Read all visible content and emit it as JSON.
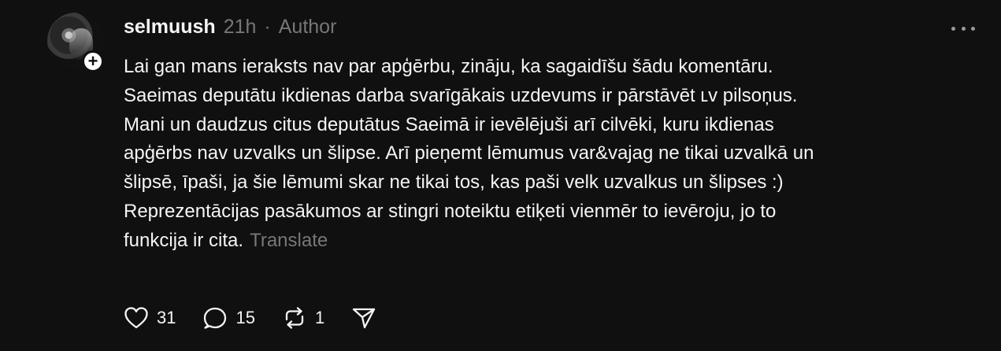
{
  "post": {
    "username": "selmuush",
    "time": "21h",
    "separator": "·",
    "author_badge": "Author",
    "follow_symbol": "+",
    "body_lines": [
      "Lai gan mans ieraksts nav par apģērbu, zināju, ka sagaidīšu šādu komentāru.",
      "Saeimas deputātu ikdienas darba svarīgākais uzdevums ir pārstāvēt ʟv pilsoņus.",
      "Mani un daudzus citus deputātus Saeimā ir ievēlējuši arī cilvēki, kuru ikdienas",
      "apģērbs nav uzvalks un šlipse. Arī pieņemt lēmumus var&vajag ne tikai uzvalkā un",
      "šlipsē, īpaši, ja šie lēmumi skar ne tikai tos, kas paši velk uzvalkus un šlipses :)",
      "Reprezentācijas pasākumos ar stingri noteiktu etiķeti vienmēr to ievēroju, jo to",
      "funkcija ir cita."
    ],
    "translate_label": "Translate"
  },
  "actions": {
    "likes": "31",
    "replies": "15",
    "reposts": "1"
  },
  "icons": {
    "more": "more-horizontal-icon",
    "like": "heart-icon",
    "reply": "comment-icon",
    "repost": "repost-icon",
    "share": "send-icon"
  },
  "colors": {
    "background": "#101010",
    "text": "#f3f5f7",
    "muted": "#777777"
  }
}
